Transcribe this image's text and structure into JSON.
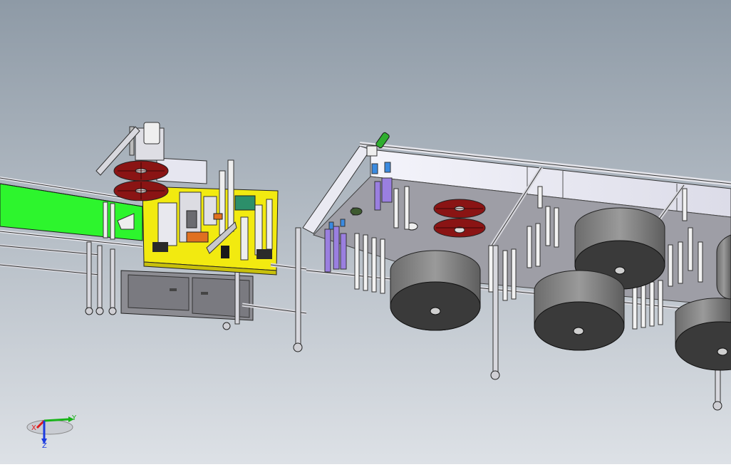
{
  "viewport": {
    "background_top": "#8e9aa6",
    "background_bottom": "#d9dde2"
  },
  "colors": {
    "frame": "#d7d8de",
    "frame_dark": "#5a5c62",
    "conveyor_green": "#2df52d",
    "station_yellow": "#f2ea10",
    "reel_red": "#8a1414",
    "roll_gray": "#7f7f7f",
    "roll_face": "#3a3a3a",
    "purple": "#9a7fe0",
    "panel_lavender": "#ececf6"
  },
  "axis_triad": {
    "x_label": "X",
    "y_label": "Y",
    "z_label": "Z",
    "x_color": "#e01b1b",
    "y_color": "#19b319",
    "z_color": "#1b3be0"
  }
}
